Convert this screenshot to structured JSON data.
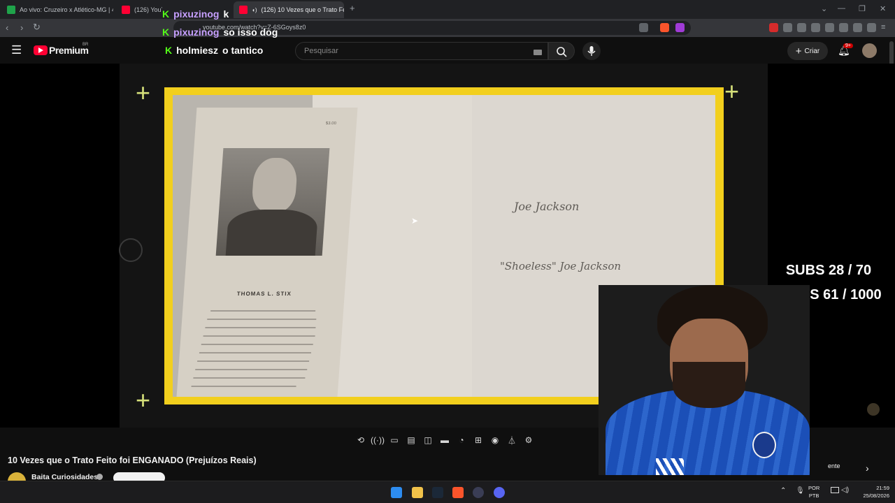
{
  "browser": {
    "tabs": [
      {
        "label": "Ao vivo: Cruzeiro x Atlético-MG | 4º d",
        "color": "#1fa34a"
      },
      {
        "label": "(126) YouTube",
        "color": "#ff0033"
      },
      {
        "label": "(126) 10 Vezes que o Trato Fe",
        "color": "#ff0033",
        "active": true
      }
    ],
    "url": "youtube.com/watch?v=Z-6SGoys8z0",
    "new_tab": "+",
    "tab_close": "✕",
    "window_controls": [
      "⌄",
      "—",
      "❐",
      "✕"
    ]
  },
  "youtube": {
    "logo_text": "Premium",
    "logo_region": "BR",
    "search_placeholder": "Pesquisar",
    "create_label": "Criar",
    "notifications_badge": "9+",
    "accent": "#ff0033"
  },
  "stream_overlay": {
    "chat": [
      {
        "user": "pixuzinog",
        "message": "k"
      },
      {
        "user": "pixuzinog",
        "message": "so isso dog"
      },
      {
        "user": "holmiesz",
        "message": "o tantico"
      }
    ],
    "subs_text": "SUBS 28 / 70",
    "kicks_text": "KICKS 61 / 1000",
    "kick_color": "#53fc18",
    "frame_color": "#f2cf1d"
  },
  "video_content": {
    "book_caption": "THOMAS L. STIX",
    "signature_1": "Joe Jackson",
    "signature_2": "\"Shoeless\" Joe Jackson",
    "price": "$3.00"
  },
  "player_controls": [
    "loop-icon",
    "broadcast-icon",
    "subtitles-icon",
    "clapper-icon",
    "frame-icon",
    "theater-icon",
    "speed-icon",
    "add-icon",
    "screenshot-icon",
    "lab-icon",
    "settings-icon"
  ],
  "video": {
    "title": "10 Vezes que o Trato Feito foi ENGANADO (Prejuízos Reais)",
    "channel": "Baita Curiosidades",
    "side_label": "ente"
  },
  "taskbar": {
    "lang_top": "POR",
    "lang_bottom": "PTB",
    "time": "21:59",
    "date": "25/08/2026"
  }
}
